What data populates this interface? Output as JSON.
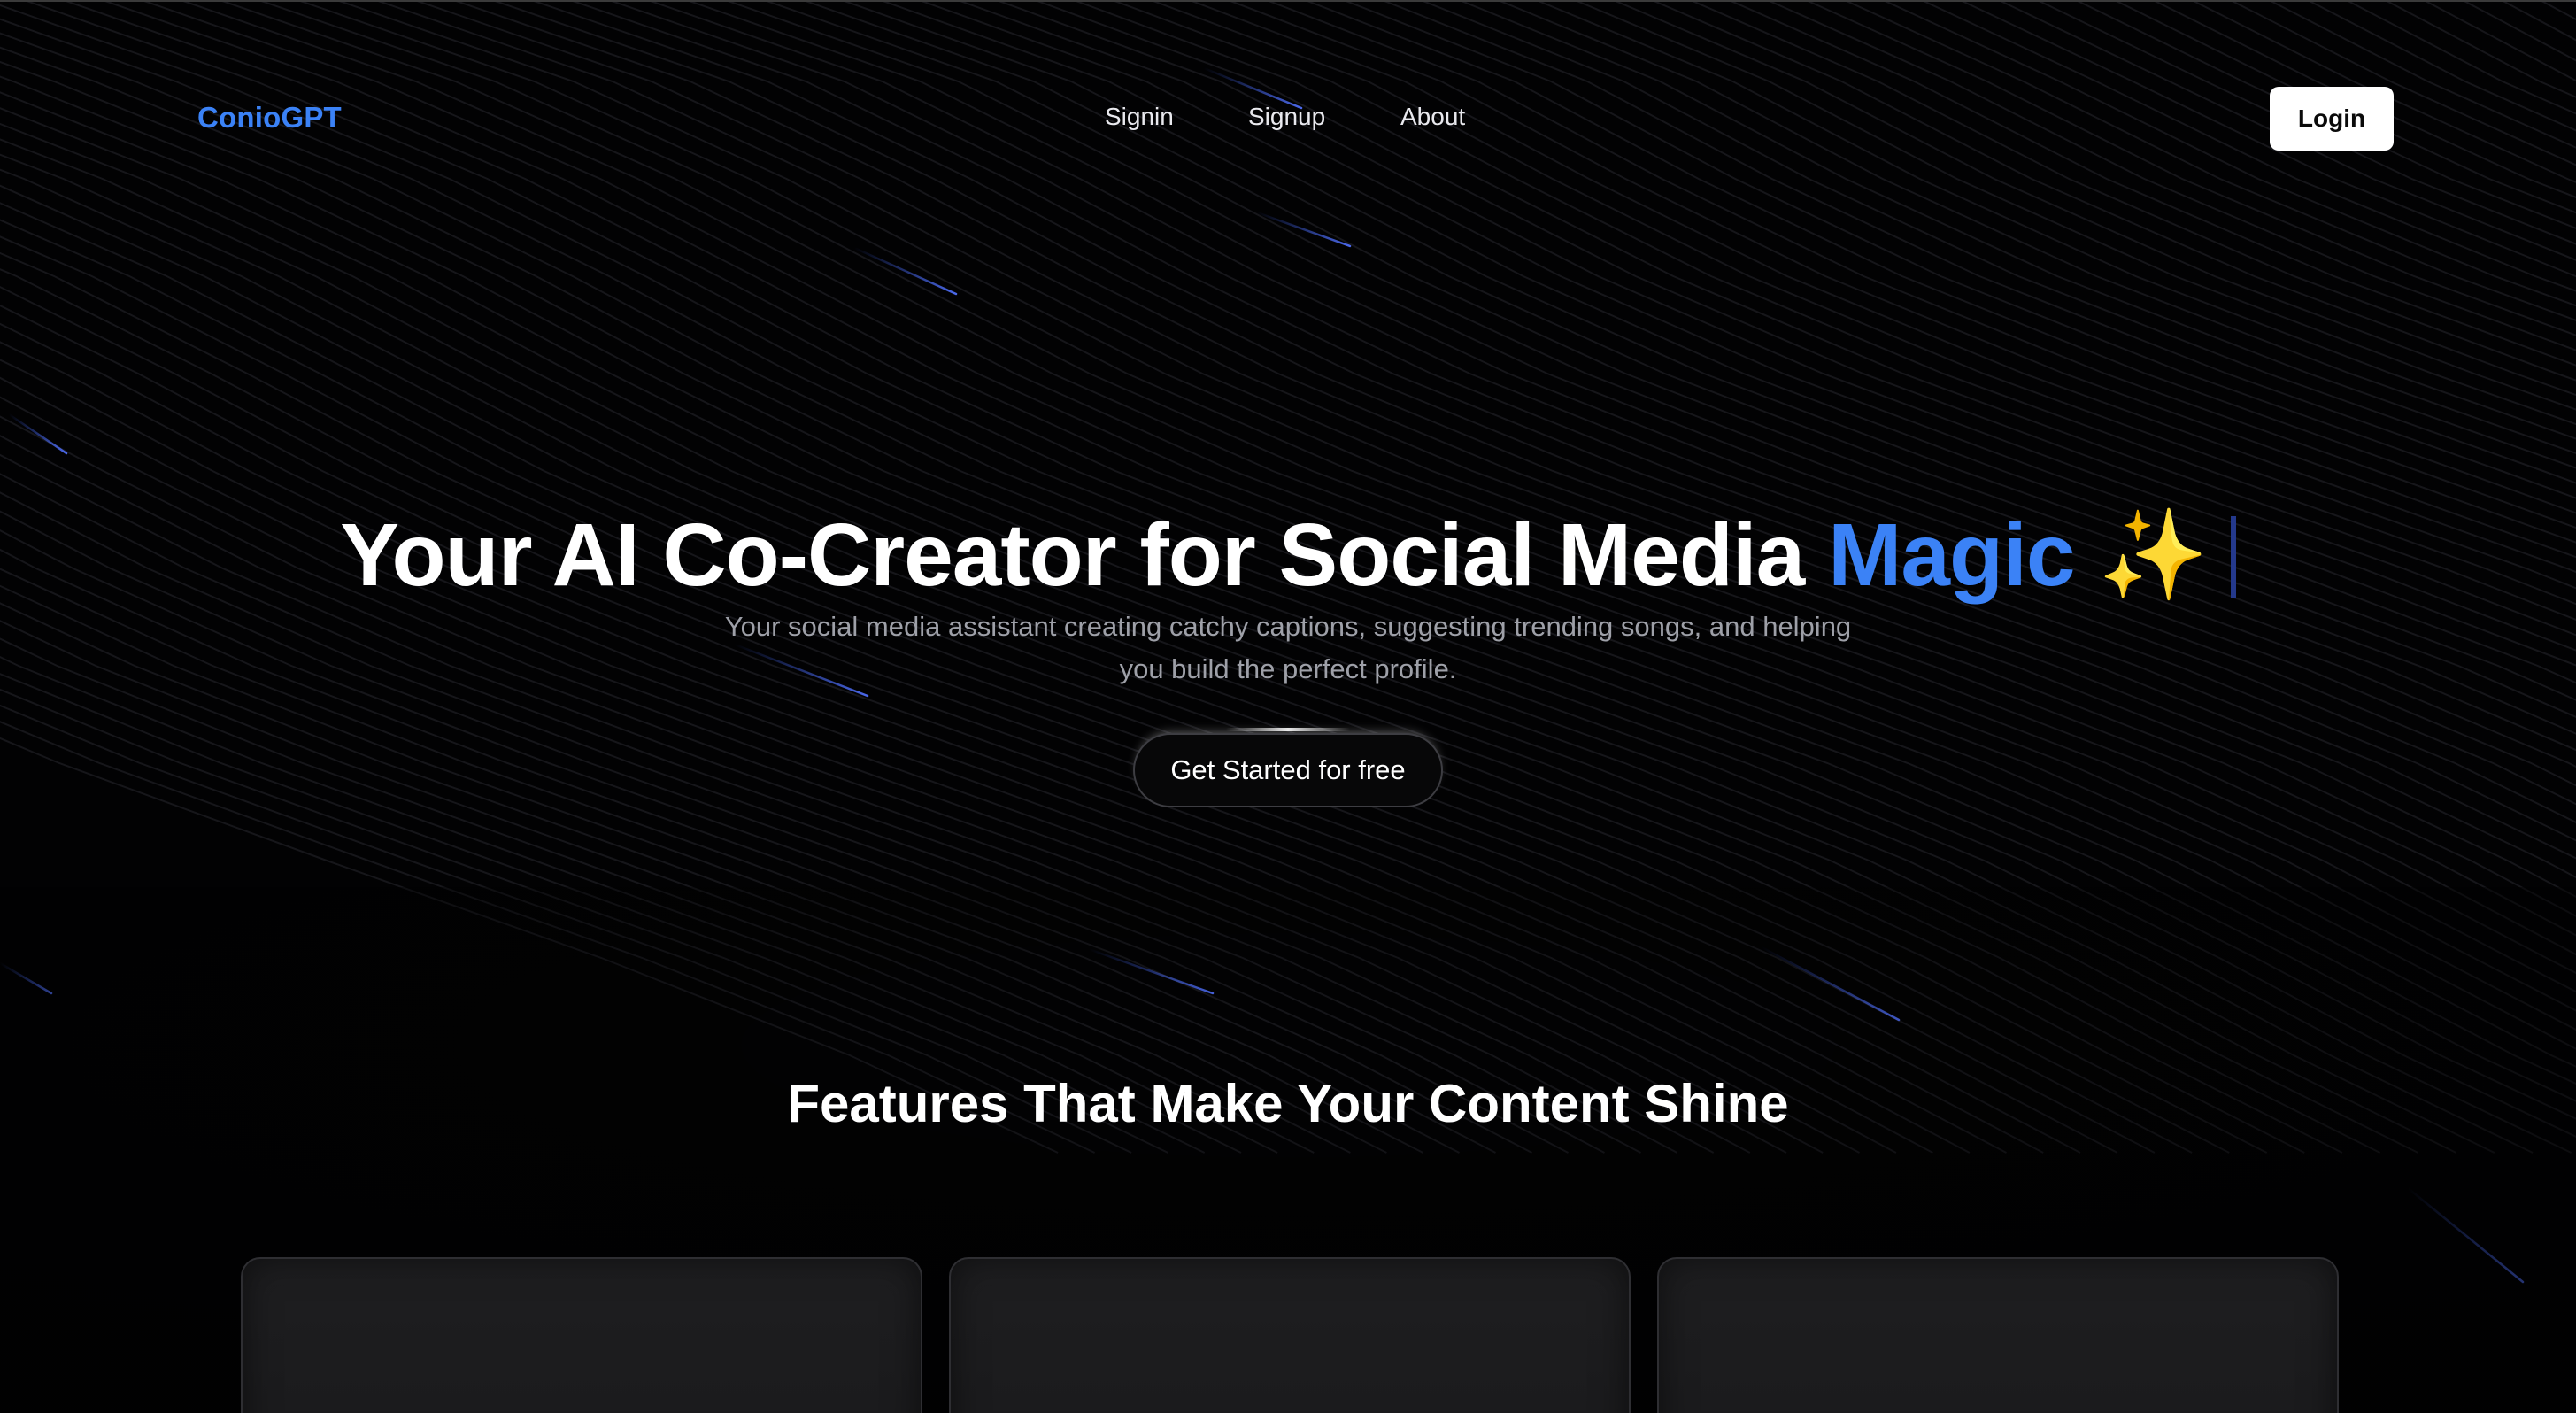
{
  "nav": {
    "brand": "ConioGPT",
    "links": [
      {
        "label": "Signin"
      },
      {
        "label": "Signup"
      },
      {
        "label": "About"
      }
    ],
    "login_label": "Login"
  },
  "hero": {
    "headline_main": "Your AI Co-Creator for Social Media ",
    "headline_accent": "Magic",
    "headline_emoji": " ✨",
    "subtitle": "Your social media assistant creating catchy captions, suggesting trending songs, and helping you build the perfect profile.",
    "cta_label": "Get Started for free"
  },
  "features": {
    "title": "Features That Make Your Content Shine",
    "cards": [
      {},
      {},
      {}
    ]
  },
  "colors": {
    "background": "#020203",
    "accent": "#3b82f6",
    "login_button_bg": "#ffffff",
    "card_bg": "#1e1e20"
  }
}
